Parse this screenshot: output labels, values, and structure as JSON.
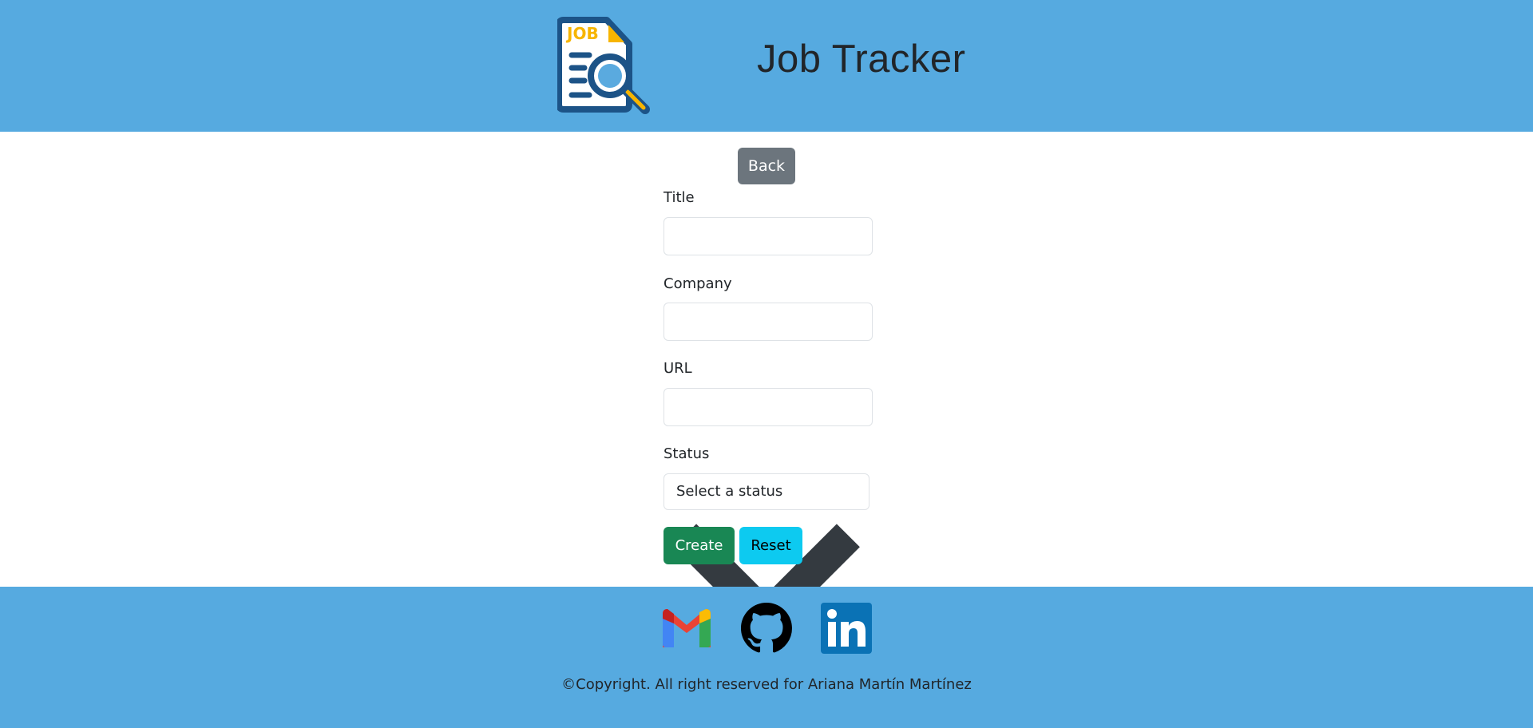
{
  "header": {
    "title": "Job Tracker",
    "logo_text": "JOB",
    "colors": {
      "background": "#56aae0"
    }
  },
  "nav": {
    "back_label": "Back"
  },
  "form": {
    "title_label": "Title",
    "title_value": "",
    "company_label": "Company",
    "company_value": "",
    "url_label": "URL",
    "url_value": "",
    "status_label": "Status",
    "status_selected": "Select a status",
    "create_label": "Create",
    "reset_label": "Reset"
  },
  "footer": {
    "icons": [
      "gmail-icon",
      "github-icon",
      "linkedin-icon"
    ],
    "copyright": "©Copyright. All right reserved for Ariana Martín Martínez"
  }
}
